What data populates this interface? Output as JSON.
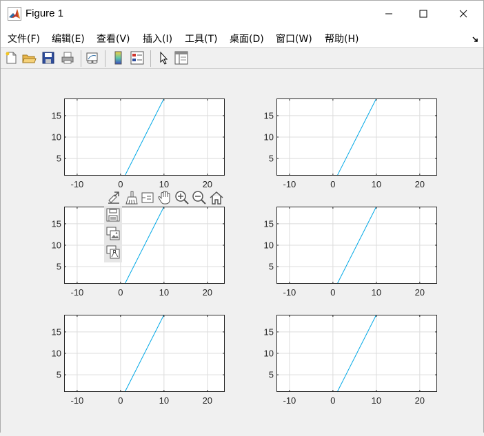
{
  "window": {
    "title": "Figure 1"
  },
  "menu": {
    "items": [
      "文件(F)",
      "编辑(E)",
      "查看(V)",
      "插入(I)",
      "工具(T)",
      "桌面(D)",
      "窗口(W)",
      "帮助(H)"
    ]
  },
  "toolbar": {
    "buttons": [
      "new-figure-icon",
      "open-file-icon",
      "save-icon",
      "print-icon",
      "link-plot-icon",
      "colorbar-icon",
      "legend-icon",
      "edit-plot-arrow-icon",
      "property-inspector-icon"
    ]
  },
  "axes_toolbar": {
    "buttons": [
      "export-icon",
      "brush-icon",
      "data-tips-icon",
      "pan-icon",
      "zoom-in-icon",
      "zoom-out-icon",
      "home-icon"
    ],
    "export_menu": [
      "save-as-icon",
      "copy-as-image-icon",
      "copy-as-vector-icon"
    ]
  },
  "colors": {
    "line": "#00a8e6",
    "grid": "#dcdcdc",
    "axes_bg": "#ffffff",
    "figure_bg": "#f0f0f0"
  },
  "chart_data": [
    {
      "type": "line",
      "position": "row1-left",
      "x": [
        1,
        10
      ],
      "y": [
        1,
        19
      ],
      "xlim": [
        -13,
        24
      ],
      "ylim": [
        1,
        19
      ],
      "xticks": [
        -10,
        0,
        10,
        20
      ],
      "yticks": [
        5,
        10,
        15
      ],
      "xtick_labels": [
        "-10",
        "0",
        "10",
        "20"
      ],
      "ytick_labels": [
        "5",
        "10",
        "15"
      ],
      "grid": true
    },
    {
      "type": "line",
      "position": "row1-right",
      "x": [
        1,
        10
      ],
      "y": [
        1,
        19
      ],
      "xlim": [
        -13,
        24
      ],
      "ylim": [
        1,
        19
      ],
      "xticks": [
        -10,
        0,
        10,
        20
      ],
      "yticks": [
        5,
        10,
        15
      ],
      "xtick_labels": [
        "-10",
        "0",
        "10",
        "20"
      ],
      "ytick_labels": [
        "5",
        "10",
        "15"
      ],
      "grid": true
    },
    {
      "type": "line",
      "position": "row2-left",
      "x": [
        1,
        10
      ],
      "y": [
        1,
        19
      ],
      "xlim": [
        -13,
        24
      ],
      "ylim": [
        1,
        19
      ],
      "xticks": [
        -10,
        0,
        10,
        20
      ],
      "yticks": [
        5,
        10,
        15
      ],
      "xtick_labels": [
        "-10",
        "0",
        "10",
        "20"
      ],
      "ytick_labels": [
        "5",
        "10",
        "15"
      ],
      "grid": true
    },
    {
      "type": "line",
      "position": "row2-right",
      "x": [
        1,
        10
      ],
      "y": [
        1,
        19
      ],
      "xlim": [
        -13,
        24
      ],
      "ylim": [
        1,
        19
      ],
      "xticks": [
        -10,
        0,
        10,
        20
      ],
      "yticks": [
        5,
        10,
        15
      ],
      "xtick_labels": [
        "-10",
        "0",
        "10",
        "20"
      ],
      "ytick_labels": [
        "5",
        "10",
        "15"
      ],
      "grid": true
    },
    {
      "type": "line",
      "position": "row3-left",
      "x": [
        1,
        10
      ],
      "y": [
        1,
        19
      ],
      "xlim": [
        -13,
        24
      ],
      "ylim": [
        1,
        19
      ],
      "xticks": [
        -10,
        0,
        10,
        20
      ],
      "yticks": [
        5,
        10,
        15
      ],
      "xtick_labels": [
        "-10",
        "0",
        "10",
        "20"
      ],
      "ytick_labels": [
        "5",
        "10",
        "15"
      ],
      "grid": true
    },
    {
      "type": "line",
      "position": "row3-right",
      "x": [
        1,
        10
      ],
      "y": [
        1,
        19
      ],
      "xlim": [
        -13,
        24
      ],
      "ylim": [
        1,
        19
      ],
      "xticks": [
        -10,
        0,
        10,
        20
      ],
      "yticks": [
        5,
        10,
        15
      ],
      "xtick_labels": [
        "-10",
        "0",
        "10",
        "20"
      ],
      "ytick_labels": [
        "5",
        "10",
        "15"
      ],
      "grid": true
    }
  ]
}
